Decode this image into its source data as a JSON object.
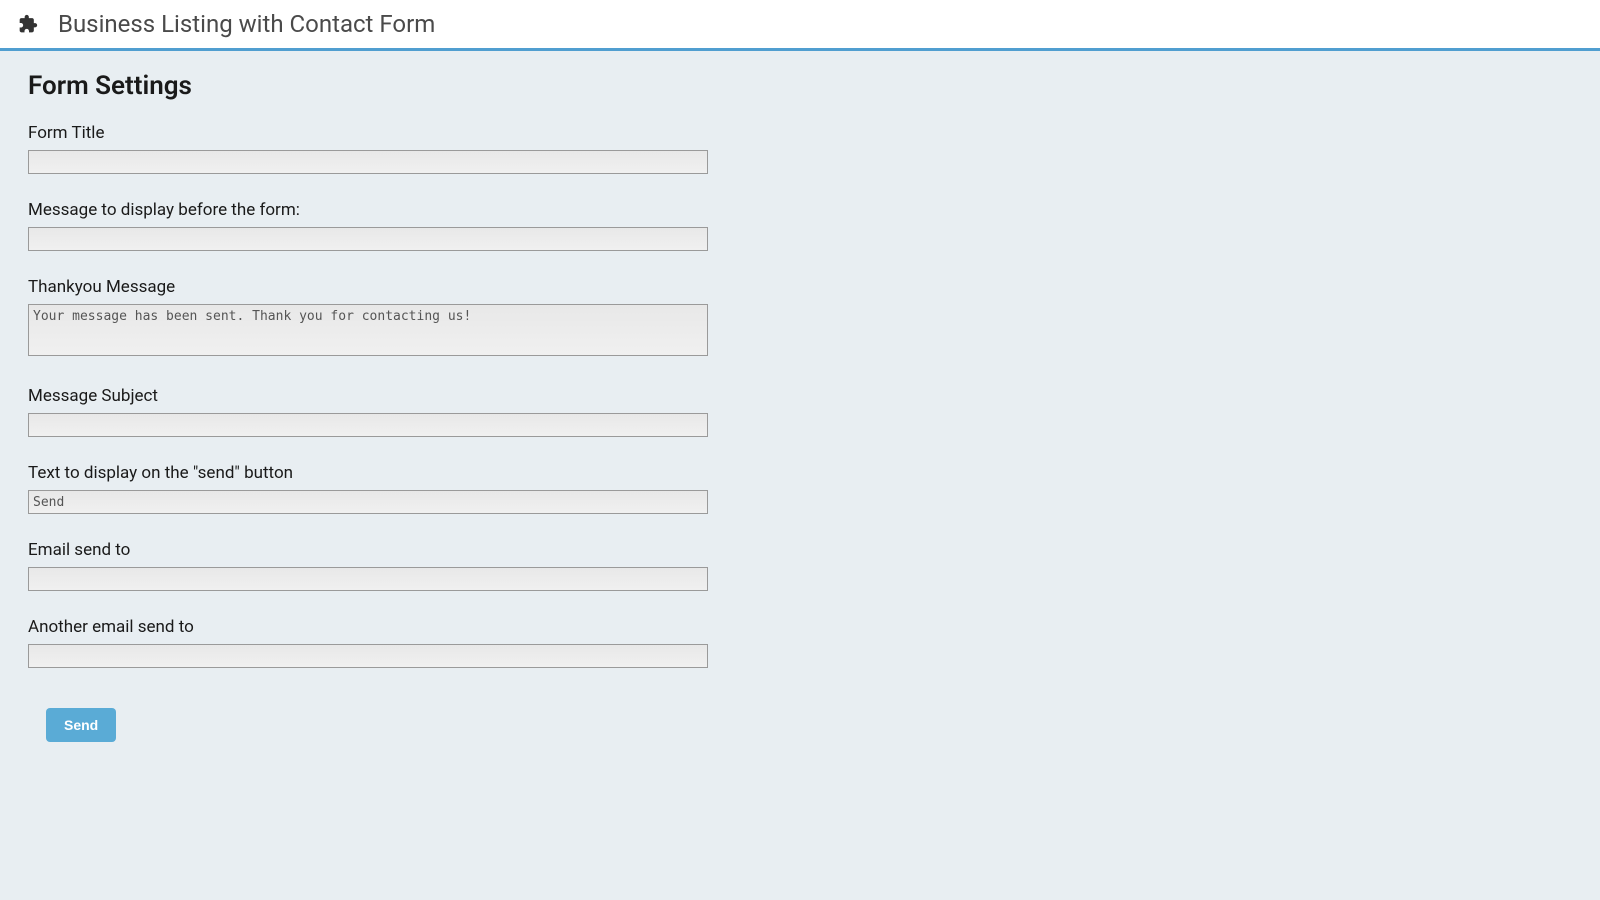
{
  "header": {
    "title": "Business Listing with Contact Form"
  },
  "section": {
    "heading": "Form Settings"
  },
  "fields": {
    "form_title": {
      "label": "Form Title",
      "value": ""
    },
    "message_before": {
      "label": "Message to display before the form:",
      "value": ""
    },
    "thankyou": {
      "label": "Thankyou Message",
      "value": "Your message has been sent. Thank you for contacting us!"
    },
    "message_subject": {
      "label": "Message Subject",
      "value": ""
    },
    "send_button_text": {
      "label": "Text to display on the \"send\" button",
      "value": "Send"
    },
    "email_send_to": {
      "label": "Email send to",
      "value": ""
    },
    "another_email": {
      "label": "Another email send to",
      "value": ""
    }
  },
  "submit": {
    "label": "Send"
  }
}
